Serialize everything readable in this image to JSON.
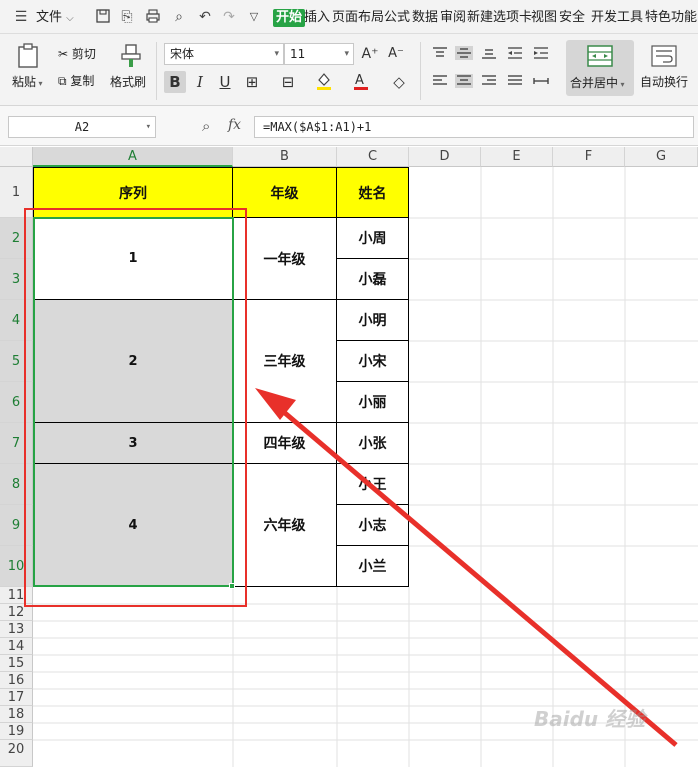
{
  "menubar": {
    "file_label": "文件",
    "tabs": [
      "开始",
      "插入",
      "页面布局",
      "公式",
      "数据",
      "审阅",
      "新建选项卡",
      "视图",
      "安全",
      "开发工具",
      "特色功能"
    ],
    "active_tab": "开始"
  },
  "ribbon": {
    "paste_label": "粘贴",
    "cut_label": "剪切",
    "copy_label": "复制",
    "format_painter_label": "格式刷",
    "font_name": "宋体",
    "font_size": "11",
    "merge_center_label": "合并居中",
    "wrap_text_label": "自动换行"
  },
  "formula_bar": {
    "name_box": "A2",
    "fx_label": "fx",
    "formula": "=MAX($A$1:A1)+1"
  },
  "grid": {
    "columns": [
      "A",
      "B",
      "C",
      "D",
      "E",
      "F",
      "G"
    ],
    "rows": [
      "1",
      "2",
      "3",
      "4",
      "5",
      "6",
      "7",
      "8",
      "9",
      "10",
      "11",
      "12",
      "13",
      "14",
      "15",
      "16",
      "17",
      "18",
      "19",
      "20"
    ],
    "header_row": {
      "a": "序列",
      "b": "年级",
      "c": "姓名"
    },
    "seq_values": [
      "1",
      "2",
      "3",
      "4"
    ],
    "grades": [
      "一年级",
      "三年级",
      "四年级",
      "六年级"
    ],
    "names": [
      "小周",
      "小磊",
      "小明",
      "小宋",
      "小丽",
      "小张",
      "小王",
      "小志",
      "小兰"
    ]
  },
  "colors": {
    "accent": "#27a345",
    "header_fill": "#ffff00",
    "selection_fill": "#d9d9d9",
    "annotation": "#e8302a"
  },
  "watermark": "Baidu 经验"
}
